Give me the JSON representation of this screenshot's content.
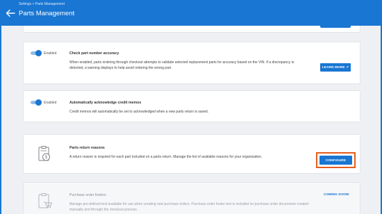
{
  "header": {
    "breadcrumb": "Settings > Parts Management",
    "title": "Parts Management"
  },
  "cards": [
    {
      "toggle_label": "Enabled",
      "title": "Check part number accuracy",
      "description": "When enabled, parts ordering through checkout attempts to validate selected replacement parts for accuracy based on the VIN.  If a discrepancy is detected, a warning displays to help avoid ordering the wrong part.",
      "button_label": "LEARN MORE ↗",
      "toggle_on": true
    },
    {
      "toggle_label": "Enabled",
      "title": "Automatically acknowledge credit memos",
      "description": "Credit memos will automatically be set to acknowledged when a new parts return is saved.",
      "toggle_on": true
    },
    {
      "icon": "clipboard-dollar-icon",
      "title": "Parts return reasons",
      "description": "A return reason is required for each part included on a parts return. Manage the list of available reasons for your organization.",
      "button_label": "CONFIGURE"
    },
    {
      "icon": "clipboard-cart-icon",
      "title": "Purchase order footers",
      "description": "Manage pre-defined text available for use when creating new purchase orders.  Purchase order footer text is included on purchase order documents created manually and through the checkout process.",
      "status_label": "COMING SOON!"
    }
  ],
  "colors": {
    "header": "#1976d2",
    "accent": "#1976d2",
    "highlight": "#e65c1c"
  }
}
